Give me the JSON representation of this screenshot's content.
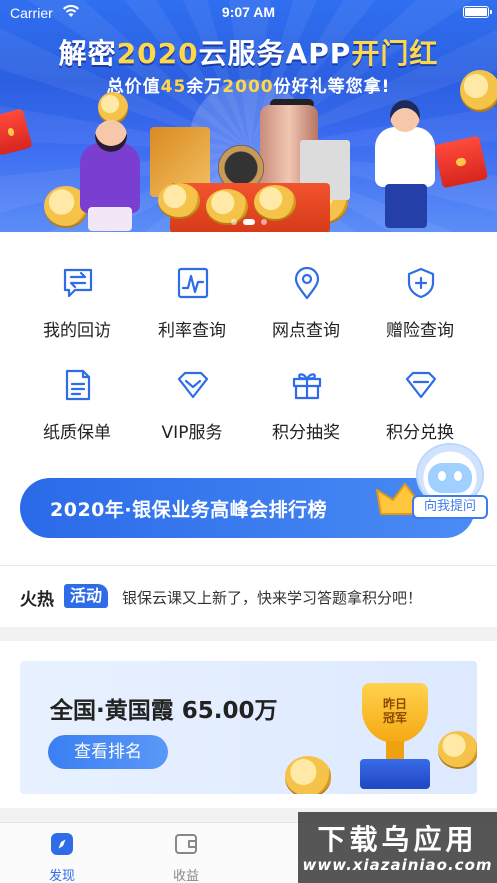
{
  "status_bar": {
    "carrier": "Carrier",
    "time": "9:07 AM"
  },
  "banner": {
    "title_prefix": "解密",
    "title_highlight": "2020",
    "title_mid": "云服务APP",
    "title_suffix_hl": "开门红",
    "subtitle_a": "总价值",
    "subtitle_n1": "45",
    "subtitle_b": "余万",
    "subtitle_n2": "2000",
    "subtitle_c": "份好礼等您拿!",
    "slide_count": 3,
    "active_slide": 1
  },
  "features": [
    {
      "label": "我的回访",
      "icon": "chat-swap-icon"
    },
    {
      "label": "利率查询",
      "icon": "chart-icon"
    },
    {
      "label": "网点查询",
      "icon": "location-pin-icon"
    },
    {
      "label": "赠险查询",
      "icon": "shield-plus-icon"
    },
    {
      "label": "纸质保单",
      "icon": "document-icon"
    },
    {
      "label": "VIP服务",
      "icon": "diamond-icon"
    },
    {
      "label": "积分抽奖",
      "icon": "gift-icon"
    },
    {
      "label": "积分兑换",
      "icon": "gem-icon"
    }
  ],
  "rank_banner": {
    "text": "2020年·银保业务高峰会排行榜"
  },
  "assistant": {
    "button": "向我提问"
  },
  "news": {
    "tag_a": "火热",
    "tag_b": "活动",
    "message": "银保云课又上新了，快来学习答题拿积分吧！"
  },
  "champion": {
    "name": "全国·黄国霞 65.00万",
    "button": "查看排名",
    "trophy_line1": "昨日",
    "trophy_line2": "冠军"
  },
  "tabbar": {
    "tabs": [
      {
        "label": "发现",
        "active": true
      },
      {
        "label": "收益",
        "active": false
      }
    ]
  },
  "watermark": {
    "big": "下载乌应用",
    "small": "www.xiazainiao.com"
  },
  "colors": {
    "accent": "#2f6de8",
    "banner_gold": "#ffd84a"
  }
}
